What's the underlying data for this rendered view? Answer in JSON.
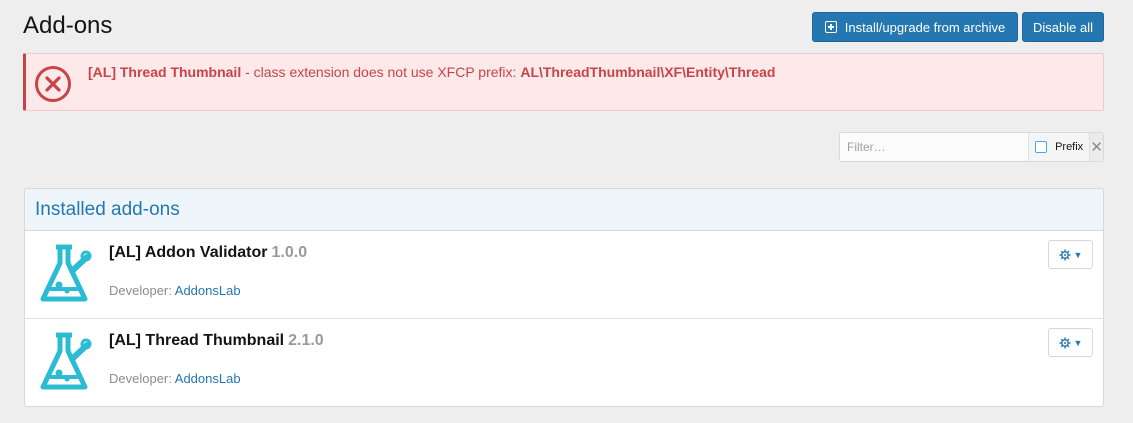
{
  "page": {
    "title": "Add-ons"
  },
  "header_buttons": {
    "install_label": "Install/upgrade from archive",
    "disable_label": "Disable all"
  },
  "error": {
    "addon_name": "[AL] Thread Thumbnail",
    "message": " - class extension does not use XFCP prefix: ",
    "class_path": "AL\\ThreadThumbnail\\XF\\Entity\\Thread"
  },
  "filter": {
    "placeholder": "Filter…",
    "prefix_label": "Prefix",
    "clear_symbol": "✕"
  },
  "installed": {
    "heading": "Installed add-ons",
    "addons": [
      {
        "name": "[AL] Addon Validator",
        "version": "1.0.0",
        "developer_label": "Developer:",
        "developer": "AddonsLab"
      },
      {
        "name": "[AL] Thread Thumbnail",
        "version": "2.1.0",
        "developer_label": "Developer:",
        "developer": "AddonsLab"
      }
    ]
  },
  "colors": {
    "primary": "#2577b1",
    "error": "#c84448",
    "error_bg": "#fde9e9",
    "logo": "#2bbcd4"
  },
  "icons": {
    "install": "plus-square-icon",
    "error": "error-x-circle-icon",
    "addon": "flask-logo-icon",
    "menu": "gear-icon"
  }
}
